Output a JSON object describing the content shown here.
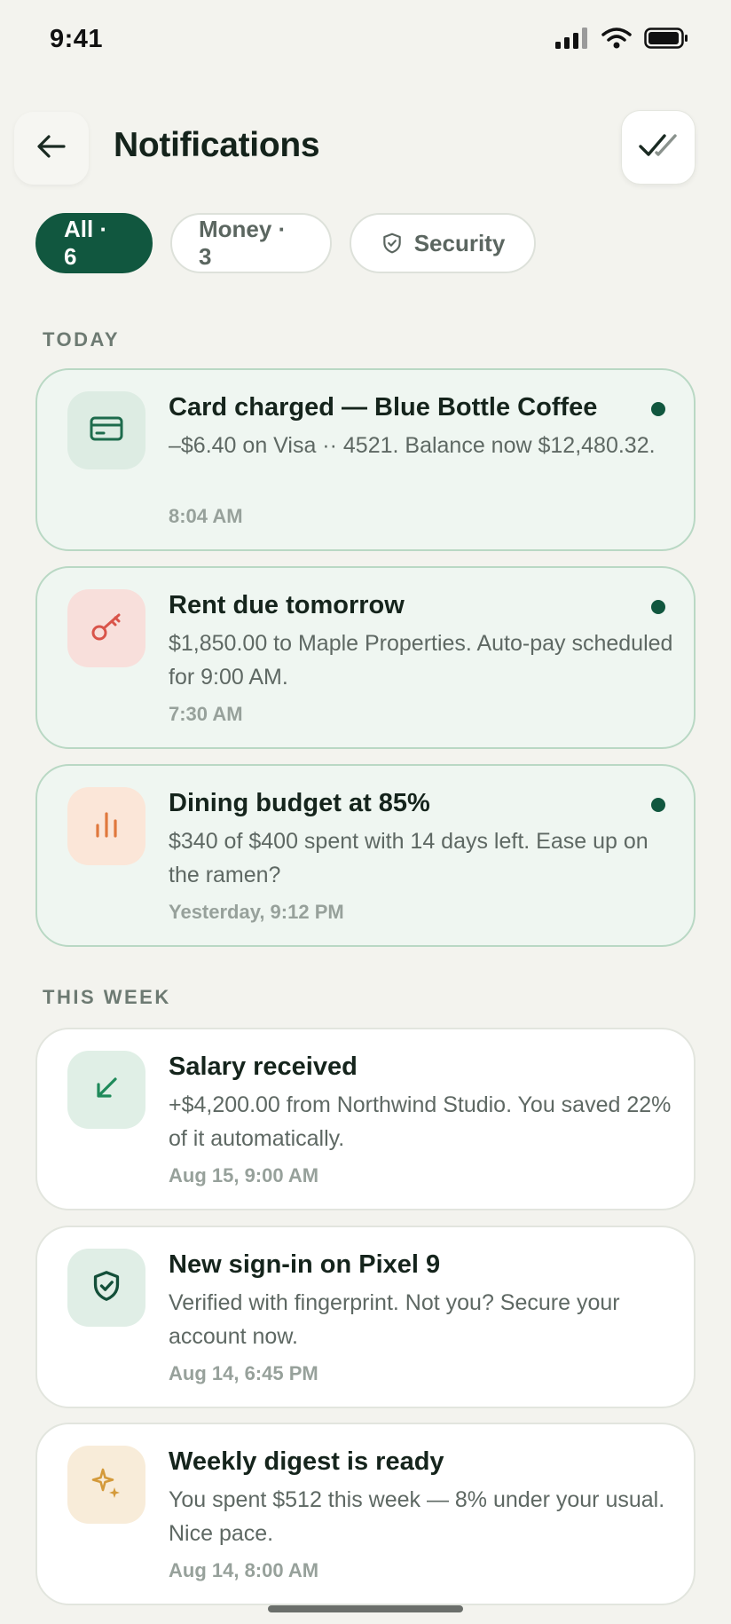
{
  "status_bar": {
    "time": "9:41",
    "icons": [
      "cellular-signal-icon",
      "wifi-icon",
      "battery-icon"
    ]
  },
  "header": {
    "back_icon": "arrow-left-icon",
    "title": "Notifications",
    "mark_all_icon": "double-check-icon"
  },
  "filters": [
    {
      "label": "All · 6",
      "active": true
    },
    {
      "label": "Money · 3",
      "active": false
    },
    {
      "label": "Security",
      "active": false,
      "icon": "shield-icon"
    }
  ],
  "sections": {
    "today": "TODAY",
    "this_week": "THIS WEEK"
  },
  "notifications": [
    {
      "title": "Card charged — Blue Bottle Coffee",
      "body": "–$6.40 on Visa ·· 4521. Balance now $12,480.32.",
      "time": "8:04 AM",
      "icon": "credit-card-icon",
      "unread": true,
      "icon_color": "#1d6b4c",
      "icon_bg": "#ddece3"
    },
    {
      "title": "Rent due tomorrow",
      "body": "$1,850.00 to Maple Properties. Auto-pay scheduled for 9:00 AM.",
      "time": "7:30 AM",
      "icon": "key-icon",
      "unread": true,
      "icon_color": "#d9544a",
      "icon_bg": "#f8dfdb"
    },
    {
      "title": "Dining budget at 85%",
      "body": "$340 of $400 spent with 14 days left. Ease up on the ramen?",
      "time": "Yesterday, 9:12 PM",
      "icon": "bar-chart-icon",
      "unread": true,
      "icon_color": "#e0783d",
      "icon_bg": "#fbe6d8"
    },
    {
      "title": "Salary received",
      "body": "+$4,200.00 from Northwind Studio. You saved 22% of it automatically.",
      "time": "Aug 15, 9:00 AM",
      "icon": "arrow-down-left-icon",
      "unread": false,
      "icon_color": "#1f8a5a",
      "icon_bg": "#e0efe6"
    },
    {
      "title": "New sign-in on Pixel 9",
      "body": "Verified with fingerprint. Not you? Secure your account now.",
      "time": "Aug 14, 6:45 PM",
      "icon": "shield-check-icon",
      "unread": false,
      "icon_color": "#134f39",
      "icon_bg": "#e0eee6"
    },
    {
      "title": "Weekly digest is ready",
      "body": "You spent $512 this week — 8% under your usual. Nice pace.",
      "time": "Aug 14, 8:00 AM",
      "icon": "sparkle-icon",
      "unread": false,
      "icon_color": "#d49a3a",
      "icon_bg": "#f8ecd9"
    }
  ],
  "colors": {
    "accent": "#11573f",
    "background": "#f3f3ee",
    "unread_card": "#eff6f1",
    "unread_border": "#b9d8c4"
  }
}
